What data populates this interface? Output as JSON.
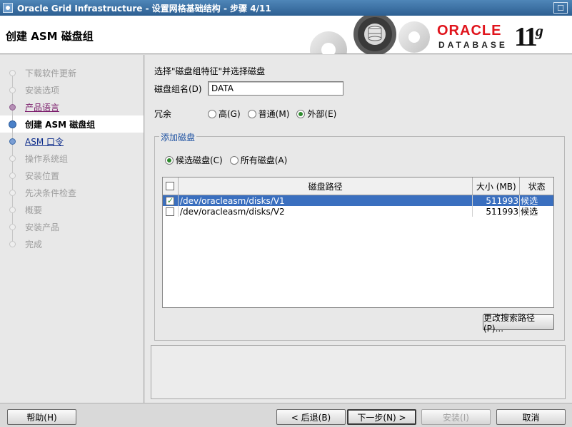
{
  "window": {
    "title": "Oracle Grid Infrastructure - 设置网格基础结构 - 步骤 4/11",
    "close_glyph": "☐"
  },
  "header": {
    "page_title": "创建 ASM 磁盘组",
    "logo_brand": "ORACLE",
    "logo_product": "DATABASE",
    "logo_version": "11",
    "logo_version_suffix": "g",
    "brand_color": "#e0141c"
  },
  "sidebar": {
    "steps": [
      {
        "label": "下载软件更新",
        "state": "disabled"
      },
      {
        "label": "安装选项",
        "state": "disabled"
      },
      {
        "label": "产品语言",
        "state": "done"
      },
      {
        "label": "创建 ASM 磁盘组",
        "state": "current"
      },
      {
        "label": "ASM 口令",
        "state": "next"
      },
      {
        "label": "操作系统组",
        "state": "disabled"
      },
      {
        "label": "安装位置",
        "state": "disabled"
      },
      {
        "label": "先决条件检查",
        "state": "disabled"
      },
      {
        "label": "概要",
        "state": "disabled"
      },
      {
        "label": "安装产品",
        "state": "disabled"
      },
      {
        "label": "完成",
        "state": "disabled"
      }
    ]
  },
  "main": {
    "instruction": "选择\"磁盘组特征\"并选择磁盘",
    "disk_group_name_label": "磁盘组名(D)",
    "disk_group_name_value": "DATA",
    "redundancy_label": "冗余",
    "redundancy_options": [
      {
        "label": "高(G)",
        "selected": false
      },
      {
        "label": "普通(M)",
        "selected": false
      },
      {
        "label": "外部(E)",
        "selected": true
      }
    ],
    "add_disks_title": "添加磁盘",
    "disk_filter_options": [
      {
        "label": "候选磁盘(C)",
        "selected": true
      },
      {
        "label": "所有磁盘(A)",
        "selected": false
      }
    ],
    "table": {
      "columns": [
        "",
        "磁盘路径",
        "大小 (MB)",
        "状态"
      ],
      "rows": [
        {
          "checked": true,
          "path": "/dev/oracleasm/disks/V1",
          "size": "511993",
          "status": "候选",
          "selected": true
        },
        {
          "checked": false,
          "path": "/dev/oracleasm/disks/V2",
          "size": "511993",
          "status": "候选",
          "selected": false
        }
      ]
    },
    "change_discovery_path_label": "更改搜索路径(P)..."
  },
  "footer": {
    "help_label": "帮助(H)",
    "back_label": "< 后退(B)",
    "next_label": "下一步(N) >",
    "install_label": "安装(I)",
    "cancel_label": "取消"
  },
  "icons": {
    "window_icon": "window-menu-icon",
    "close_icon": "maximize-icon",
    "check_glyph": "✓"
  }
}
